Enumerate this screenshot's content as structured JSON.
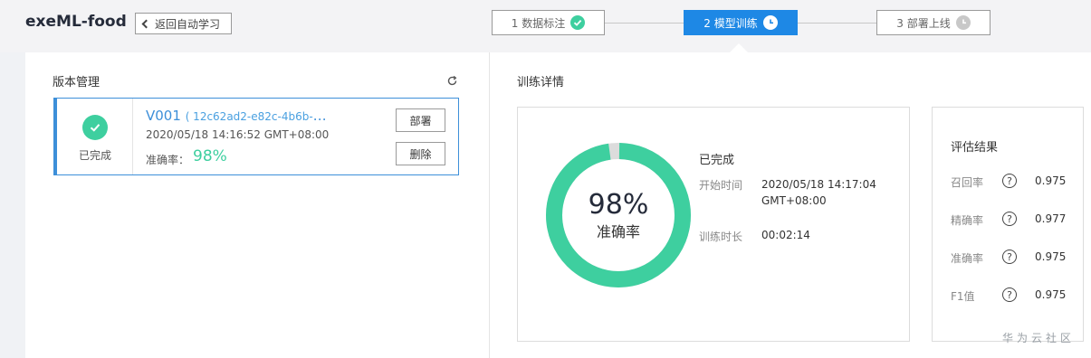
{
  "header": {
    "title": "exeML-food",
    "back_label": "返回自动学习"
  },
  "steps": [
    {
      "label": "1 数据标注",
      "icon": "check-icon",
      "state": "done"
    },
    {
      "label": "2 模型训练",
      "icon": "clock-icon",
      "state": "active"
    },
    {
      "label": "3 部署上线",
      "icon": "clock-icon",
      "state": "pending"
    }
  ],
  "version_panel": {
    "title": "版本管理",
    "card": {
      "status": "已完成",
      "version": "V001",
      "id": "( 12c62ad2-e82c-4b6b-b6...",
      "time": "2020/05/18 14:16:52 GMT+08:00",
      "accuracy_label": "准确率：",
      "accuracy_value": "98%",
      "deploy_label": "部署",
      "delete_label": "删除"
    }
  },
  "training_panel": {
    "title": "训练详情",
    "donut": {
      "percent_text": "98%",
      "label": "准确率",
      "fraction": 0.98
    },
    "status": "已完成",
    "start_time_label": "开始时间",
    "start_time_value": "2020/05/18 14:17:04",
    "start_time_tz": "GMT+08:00",
    "duration_label": "训练时长",
    "duration_value": "00:02:14"
  },
  "evaluation": {
    "title": "评估结果",
    "metrics": [
      {
        "label": "召回率",
        "value": "0.975"
      },
      {
        "label": "精确率",
        "value": "0.977"
      },
      {
        "label": "准确率",
        "value": "0.975"
      },
      {
        "label": "F1值",
        "value": "0.975"
      }
    ]
  },
  "watermark": "华为云社区",
  "colors": {
    "accent_blue": "#1e88e5",
    "success_green": "#3ecf9f",
    "donut_rest": "#dcdcdc"
  }
}
